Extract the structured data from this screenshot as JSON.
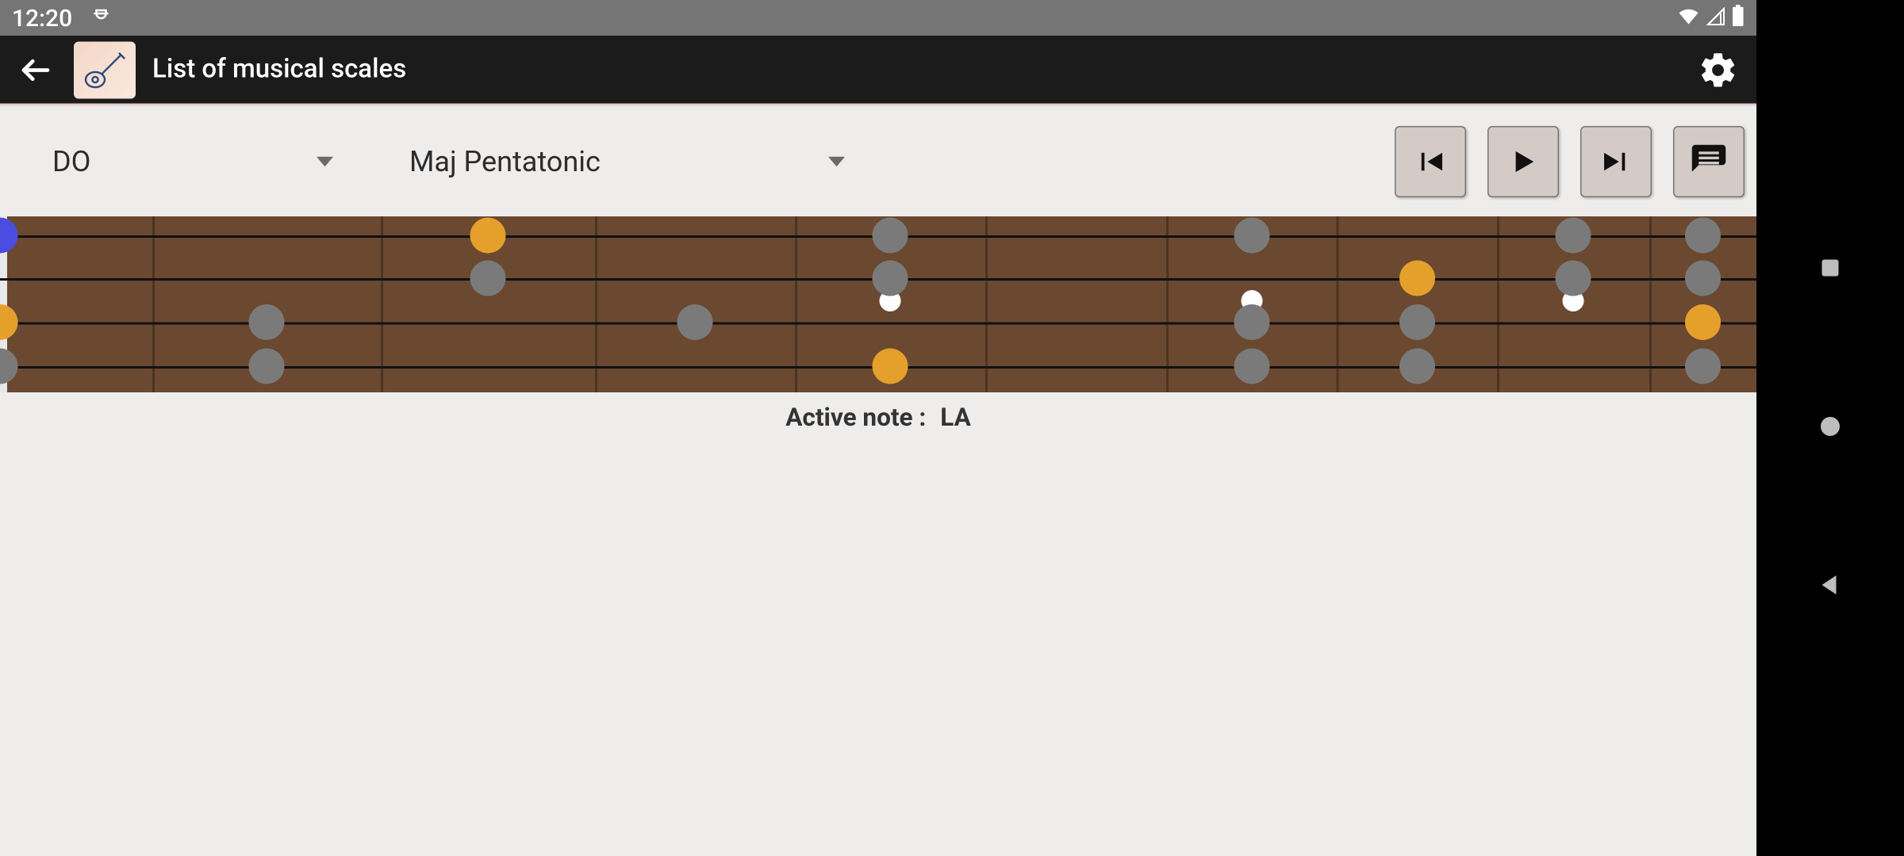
{
  "statusbar": {
    "time": "12:20"
  },
  "appbar": {
    "title": "List of musical scales"
  },
  "controls": {
    "root_note": "DO",
    "scale_type": "Maj Pentatonic"
  },
  "active_note": {
    "label": "Active note :",
    "value": "LA"
  },
  "fretboard": {
    "strings_y": [
      16,
      52,
      89,
      126
    ],
    "fret_x": [
      128,
      320,
      500,
      668,
      828,
      980,
      1123,
      1258,
      1386
    ],
    "fret_label_x": [
      67,
      224,
      410,
      584,
      748,
      904,
      1052,
      1191,
      1322,
      1431
    ],
    "position_markers": [
      {
        "fret": 4,
        "y": 71
      },
      {
        "fret": 6,
        "y": 71
      },
      {
        "fret": 8,
        "y": 71
      }
    ],
    "notes": [
      {
        "string": 0,
        "fret": -1,
        "color": "blue"
      },
      {
        "string": 0,
        "fret": 2,
        "color": "orange"
      },
      {
        "string": 0,
        "fret": 4,
        "color": "grey"
      },
      {
        "string": 0,
        "fret": 6,
        "color": "grey"
      },
      {
        "string": 0,
        "fret": 8,
        "color": "grey"
      },
      {
        "string": 0,
        "fret": 9,
        "color": "grey"
      },
      {
        "string": 1,
        "fret": 2,
        "color": "grey"
      },
      {
        "string": 1,
        "fret": 4,
        "color": "grey"
      },
      {
        "string": 1,
        "fret": 7,
        "color": "orange"
      },
      {
        "string": 1,
        "fret": 8,
        "color": "grey"
      },
      {
        "string": 1,
        "fret": 9,
        "color": "grey"
      },
      {
        "string": 2,
        "fret": -1,
        "color": "orange"
      },
      {
        "string": 2,
        "fret": 1,
        "color": "grey"
      },
      {
        "string": 2,
        "fret": 3,
        "color": "grey"
      },
      {
        "string": 2,
        "fret": 6,
        "color": "grey"
      },
      {
        "string": 2,
        "fret": 7,
        "color": "grey"
      },
      {
        "string": 2,
        "fret": 9,
        "color": "orange"
      },
      {
        "string": 3,
        "fret": -1,
        "color": "grey"
      },
      {
        "string": 3,
        "fret": 1,
        "color": "grey"
      },
      {
        "string": 3,
        "fret": 4,
        "color": "orange"
      },
      {
        "string": 3,
        "fret": 6,
        "color": "grey"
      },
      {
        "string": 3,
        "fret": 7,
        "color": "grey"
      },
      {
        "string": 3,
        "fret": 9,
        "color": "grey"
      }
    ]
  }
}
